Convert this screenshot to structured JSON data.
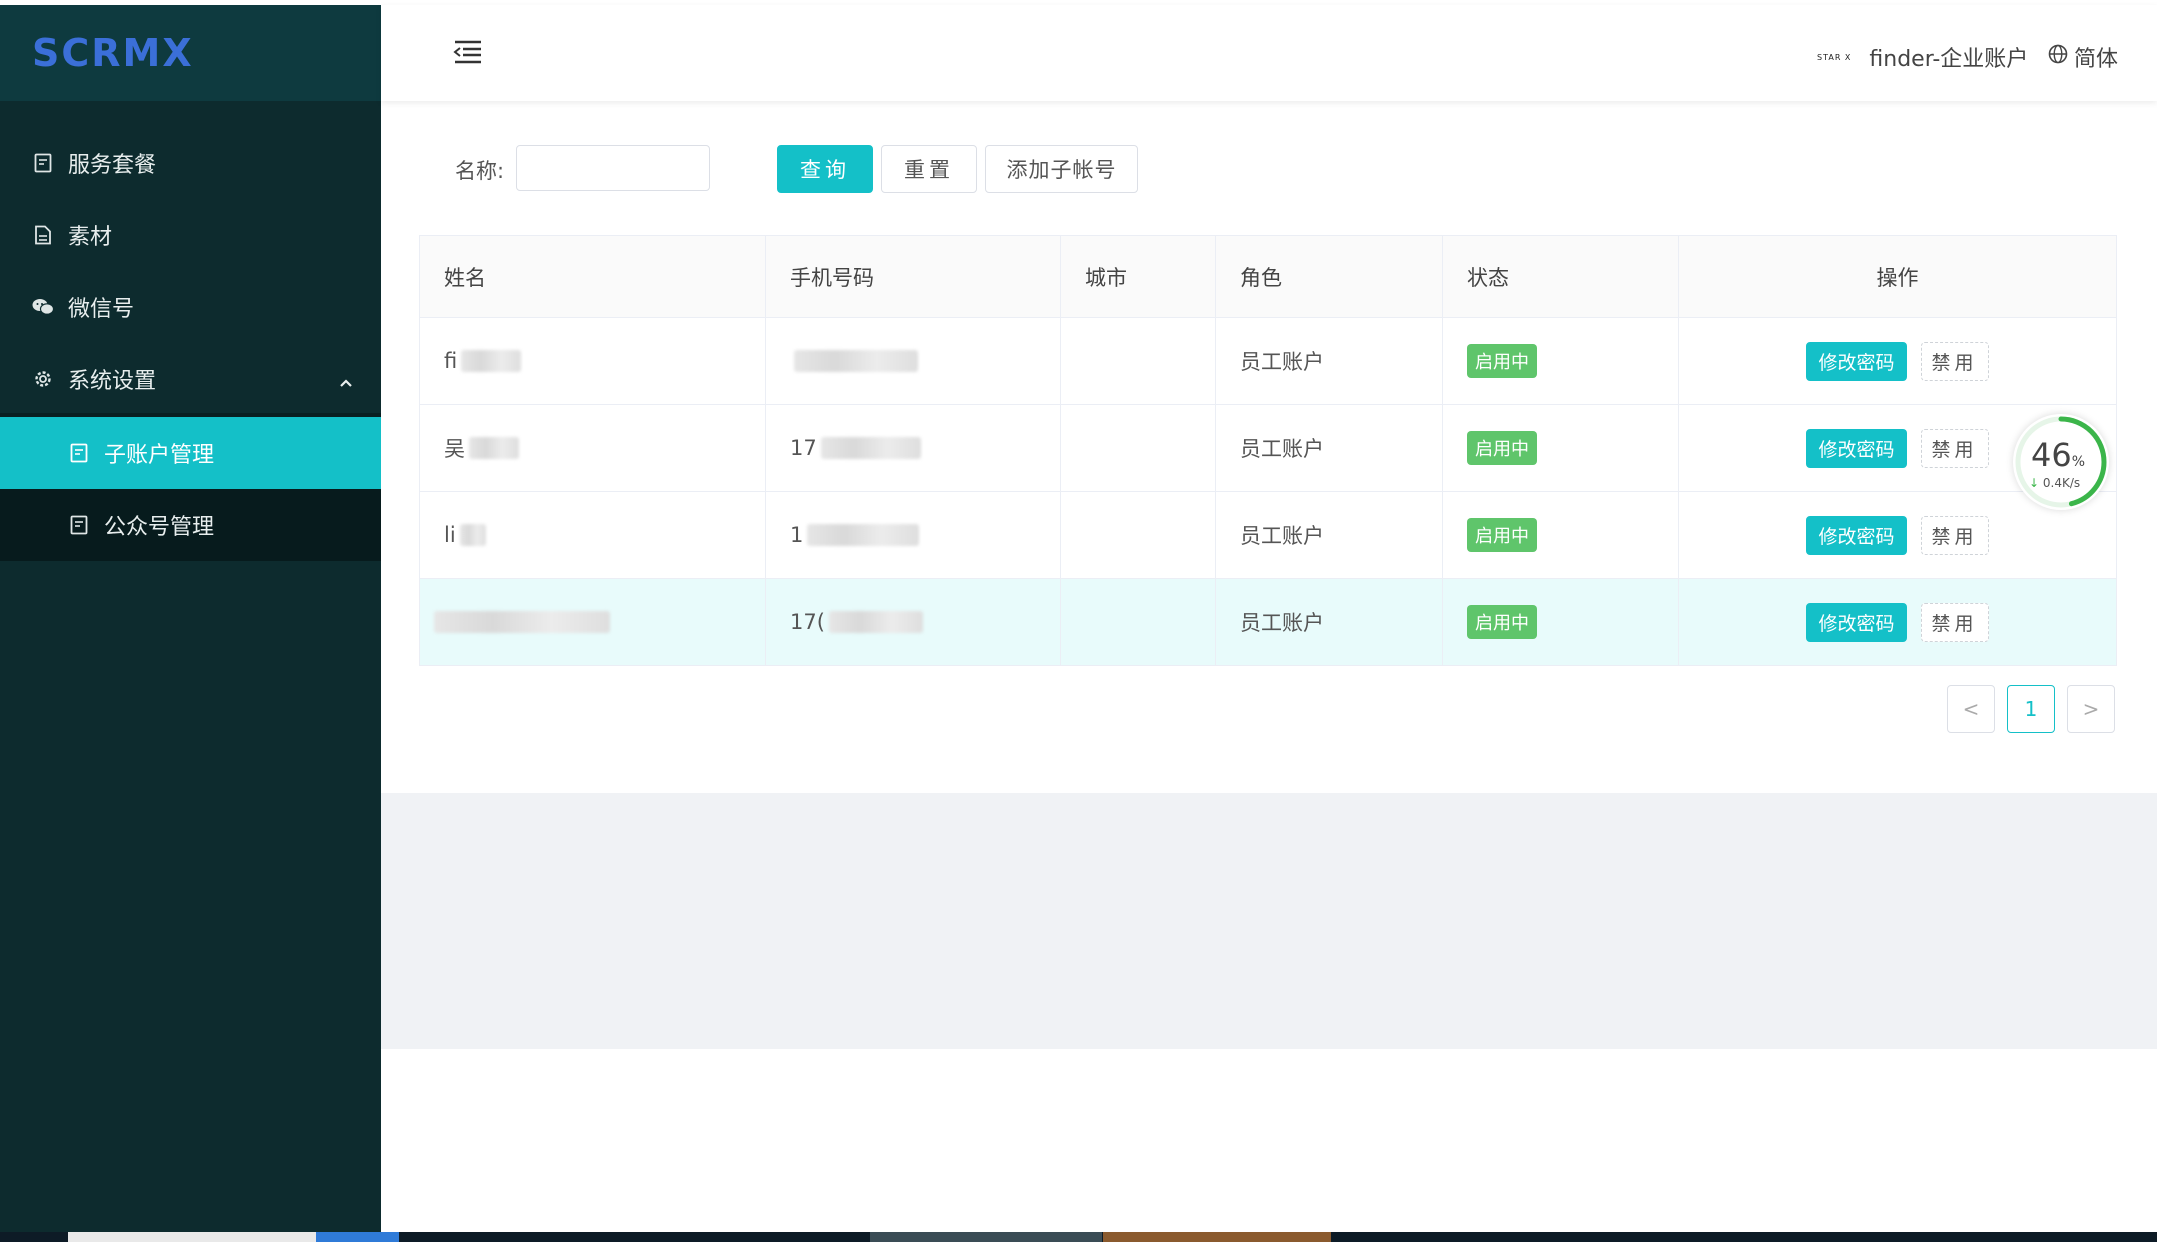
{
  "app": {
    "logo_text": "SCRMX"
  },
  "sidebar": {
    "items": [
      {
        "label": "服务套餐",
        "icon": "clipboard-icon"
      },
      {
        "label": "素材",
        "icon": "document-icon"
      },
      {
        "label": "微信号",
        "icon": "wechat-icon"
      },
      {
        "label": "系统设置",
        "icon": "gear-icon",
        "expanded": true
      },
      {
        "label": "子账户管理",
        "icon": "clipboard-icon",
        "active": true
      },
      {
        "label": "公众号管理",
        "icon": "clipboard-icon"
      }
    ]
  },
  "header": {
    "account_logo": "STAR X",
    "account_name": "finder-企业账户",
    "language": "简体"
  },
  "search": {
    "name_label": "名称:",
    "name_value": "",
    "query_button": "查询",
    "reset_button": "重置",
    "add_button": "添加子帐号"
  },
  "table": {
    "columns": [
      "姓名",
      "手机号码",
      "城市",
      "角色",
      "状态",
      "操作"
    ],
    "rows": [
      {
        "name_prefix": "fi",
        "phone_prefix": "",
        "city": "",
        "role": "员工账户",
        "status": "启用中",
        "op_primary": "修改密码",
        "op_secondary": "禁用"
      },
      {
        "name_prefix": "吴",
        "phone_prefix": "17",
        "city": "",
        "role": "员工账户",
        "status": "启用中",
        "op_primary": "修改密码",
        "op_secondary": "禁用"
      },
      {
        "name_prefix": "li",
        "phone_prefix": "1",
        "city": "",
        "role": "员工账户",
        "status": "启用中",
        "op_primary": "修改密码",
        "op_secondary": "禁用"
      },
      {
        "name_prefix": "",
        "phone_prefix": "17(",
        "city": "",
        "role": "员工账户",
        "status": "启用中",
        "op_primary": "修改密码",
        "op_secondary": "禁用"
      }
    ]
  },
  "pagination": {
    "prev": "<",
    "current": "1",
    "next": ">"
  },
  "speed_widget": {
    "percent": "46",
    "percent_unit": "%",
    "rate": "0.4K/s",
    "fraction": 0.46
  },
  "colors": {
    "accent": "#14c0c8",
    "sidebar_bg": "#0d2b2e",
    "status_green": "#5fc56b"
  }
}
